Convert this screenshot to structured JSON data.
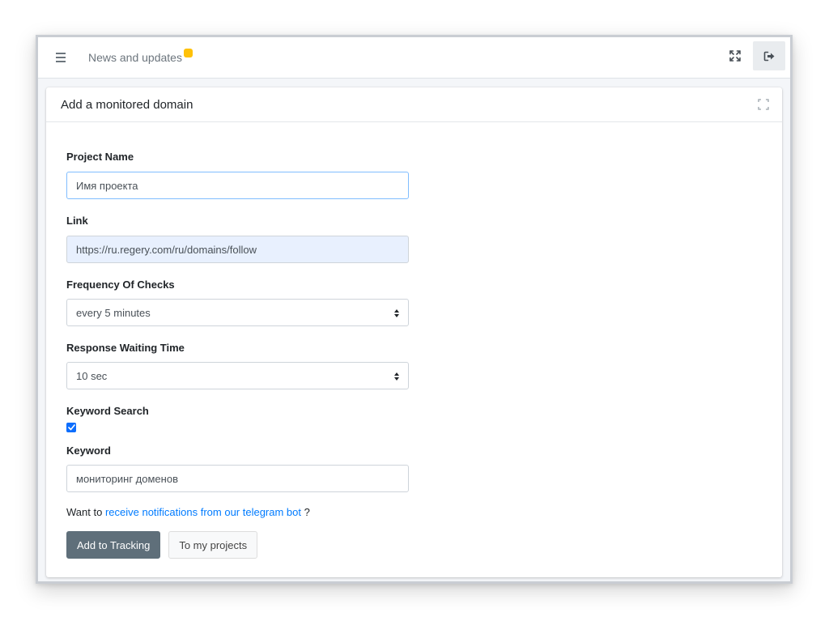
{
  "topbar": {
    "menu_icon": "hamburger-menu-icon",
    "news_link": "News and updates",
    "badge_color": "#ffc107",
    "fullscreen_icon": "expand-arrows-icon",
    "logout_icon": "sign-out-icon"
  },
  "card": {
    "title": "Add a monitored domain",
    "maximize_icon": "maximize-corners-icon"
  },
  "form": {
    "project_name": {
      "label": "Project Name",
      "value": "Имя проекта"
    },
    "link": {
      "label": "Link",
      "value": "https://ru.regery.com/ru/domains/follow"
    },
    "frequency": {
      "label": "Frequency Of Checks",
      "selected": "every 5 minutes"
    },
    "response_time": {
      "label": "Response Waiting Time",
      "selected": "10 sec"
    },
    "keyword_search": {
      "label": "Keyword Search",
      "checked": true
    },
    "keyword": {
      "label": "Keyword",
      "value": "мониторинг доменов"
    },
    "telegram_note": {
      "prefix": "Want to",
      "link": "receive notifications from our telegram bot",
      "suffix": "?"
    },
    "buttons": {
      "submit": "Add to Tracking",
      "projects": "To my projects"
    }
  },
  "colors": {
    "primary_button": "#5f6f7a",
    "link": "#007bff",
    "checkbox": "#0d6efd",
    "focus_border": "#80bdff",
    "autofill_bg": "#e8f0fe"
  }
}
